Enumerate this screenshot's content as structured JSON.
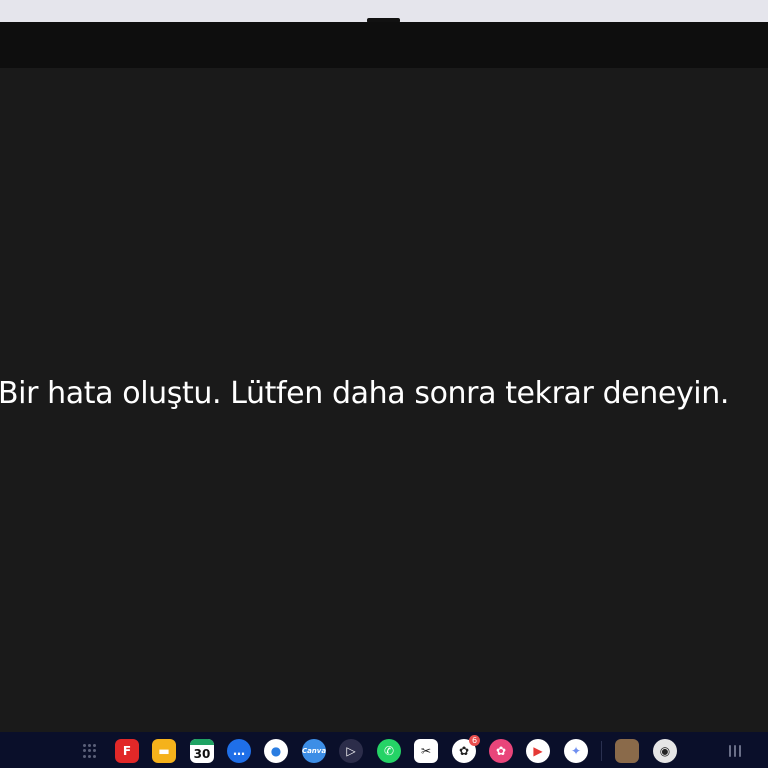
{
  "error": {
    "message": "Bir hata oluştu. Lütfen daha sonra tekrar deneyin."
  },
  "taskbar": {
    "apps": [
      {
        "name": "flipboard",
        "icon": "flipboard-icon",
        "glyph": "F",
        "color": "#e12828"
      },
      {
        "name": "files",
        "icon": "folder-icon",
        "glyph": "▬",
        "color": "#f5b21b"
      },
      {
        "name": "calendar",
        "icon": "calendar-icon",
        "glyph": "30",
        "color": "#ffffff"
      },
      {
        "name": "messages",
        "icon": "chat-bubble-icon",
        "glyph": "…",
        "color": "#1f6fe8"
      },
      {
        "name": "chrome",
        "icon": "chrome-icon",
        "glyph": "●",
        "color": "#ffffff"
      },
      {
        "name": "canva",
        "icon": "canva-icon",
        "glyph": "Canva",
        "color": "#3d8ee6"
      },
      {
        "name": "play-games",
        "icon": "play-icon",
        "glyph": "▷",
        "color": "#2c2d4a"
      },
      {
        "name": "whatsapp",
        "icon": "whatsapp-icon",
        "glyph": "✆",
        "color": "#25d366"
      },
      {
        "name": "capcut",
        "icon": "capcut-icon",
        "glyph": "✂",
        "color": "#ffffff"
      },
      {
        "name": "chatgpt",
        "icon": "openai-icon",
        "glyph": "✿",
        "color": "#ffffff",
        "badge": "6"
      },
      {
        "name": "gallery",
        "icon": "flower-icon",
        "glyph": "✿",
        "color": "#e9457a"
      },
      {
        "name": "youtube-music",
        "icon": "youtube-music-icon",
        "glyph": "▶",
        "color": "#ffffff"
      },
      {
        "name": "gemini",
        "icon": "sparkle-icon",
        "glyph": "✦",
        "color": "#ffffff"
      },
      {
        "name": "avatar-app",
        "icon": "avatar-icon",
        "glyph": "",
        "color": "#8a6a4a"
      },
      {
        "name": "camera",
        "icon": "camera-icon",
        "glyph": "◉",
        "color": "#e6e6e6"
      }
    ]
  }
}
